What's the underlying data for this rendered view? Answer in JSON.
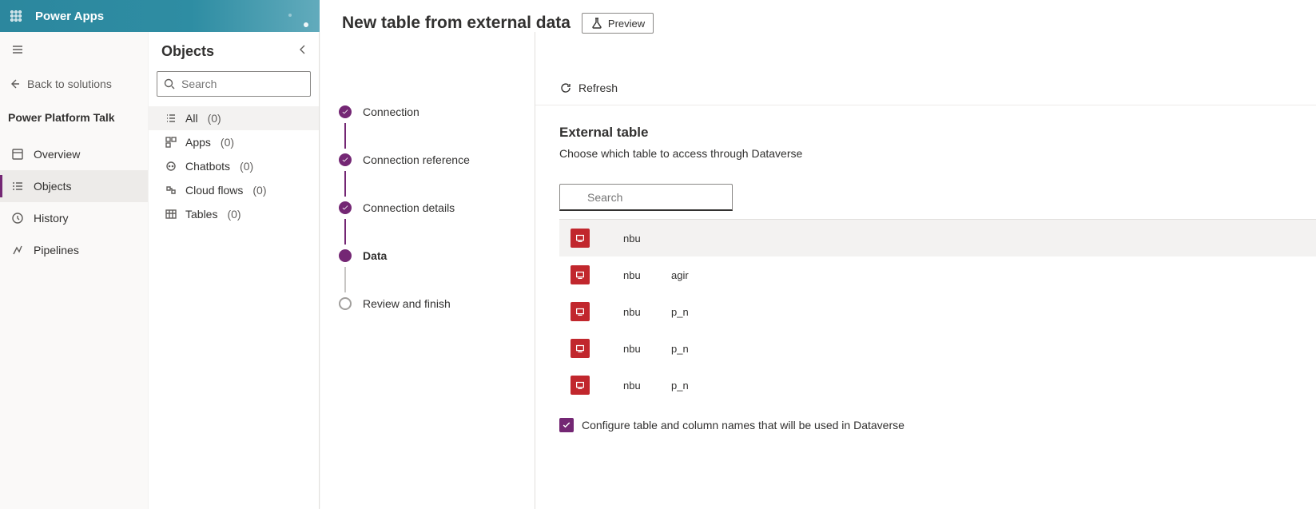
{
  "appbar": {
    "brand": "Power Apps"
  },
  "leftnav": {
    "back": "Back to solutions",
    "section": "Power Platform Talk",
    "items": [
      {
        "label": "Overview"
      },
      {
        "label": "Objects"
      },
      {
        "label": "History"
      },
      {
        "label": "Pipelines"
      }
    ]
  },
  "objects": {
    "title": "Objects",
    "search_placeholder": "Search",
    "rows": [
      {
        "label": "All",
        "count": "(0)"
      },
      {
        "label": "Apps",
        "count": "(0)"
      },
      {
        "label": "Chatbots",
        "count": "(0)"
      },
      {
        "label": "Cloud flows",
        "count": "(0)"
      },
      {
        "label": "Tables",
        "count": "(0)"
      }
    ]
  },
  "page": {
    "title": "New table from external data",
    "preview": "Preview"
  },
  "wizard": {
    "steps": [
      "Connection",
      "Connection reference",
      "Connection details",
      "Data",
      "Review and finish"
    ]
  },
  "main": {
    "refresh": "Refresh",
    "heading": "External table",
    "sub": "Choose which table to access through Dataverse",
    "search_placeholder": "Search",
    "rows": [
      {
        "c1": "nbu",
        "c2": ""
      },
      {
        "c1": "nbu",
        "c2": "agir"
      },
      {
        "c1": "nbu",
        "c2": "p_n"
      },
      {
        "c1": "nbu",
        "c2": "p_n"
      },
      {
        "c1": "nbu",
        "c2": "p_n"
      }
    ],
    "configure": "Configure table and column names that will be used in Dataverse"
  }
}
